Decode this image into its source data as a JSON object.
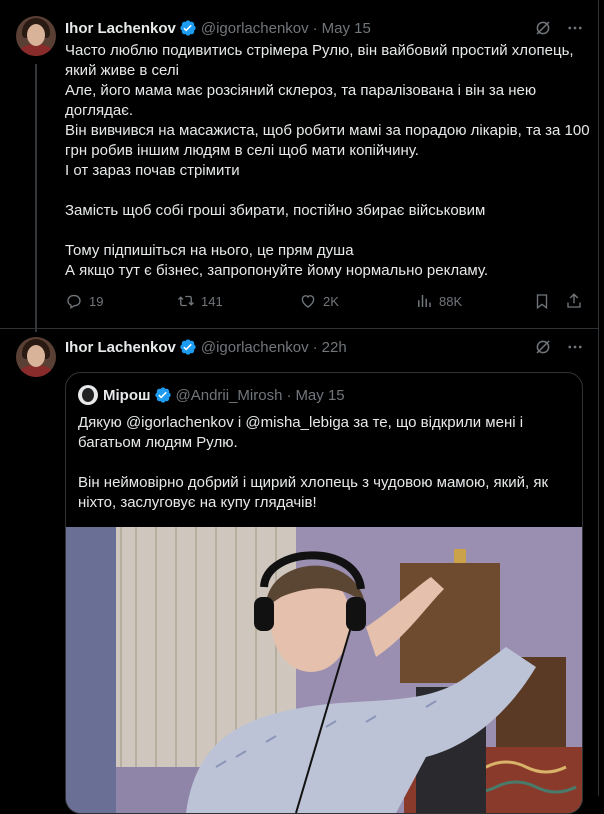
{
  "tweet1": {
    "name": "Ihor Lachenkov",
    "handle": "@igorlachenkov",
    "separator": "·",
    "date": "May 15",
    "lines": [
      "Часто люблю подивитись стрімера Рулю, він вайбовий простий хлопець,",
      "який живе в селі",
      "Але, його мама має розсіяний склероз, та паралізована і він за нею",
      "доглядає.",
      "Він вивчився на масажиста, щоб робити мамі за порадою лікарів, та за 100",
      "грн робив іншим людям в селі щоб мати копійчину.",
      "І от зараз почав стрімити",
      "Замість щоб собі гроші збирати, постійно збирає військовим",
      "Тому підпишіться на нього, це прям душа",
      "А якщо тут є бізнес, запропонуйте йому нормально рекламу."
    ],
    "actions": {
      "replies": "19",
      "reposts": "141",
      "likes": "2K",
      "views": "88K"
    }
  },
  "tweet2": {
    "name": "Ihor Lachenkov",
    "handle": "@igorlachenkov",
    "separator": "·",
    "date": "22h",
    "quote": {
      "name": "Мірош",
      "handle": "@Andrii_Mirosh",
      "separator": "·",
      "date": "May 15",
      "line1_prefix": "Дякую ",
      "mention1": "@igorlachenkov",
      "line1_mid": " і ",
      "mention2": "@misha_lebiga",
      "line1_suffix": " за те, що відкрили мені і",
      "line2": "багатьом людям Рулю.",
      "line3": "Він неймовірно добрий і щирий хлопець з чудовою мамою, який, як",
      "line4": "ніхто, заслуговує на купу глядачів!"
    }
  },
  "colors": {
    "background": "#000000",
    "text": "#e7e9ea",
    "muted": "#71767b",
    "verified": "#1d9bf0",
    "border": "#2f3336"
  },
  "icons": [
    "grok-icon",
    "more-icon",
    "verified-icon",
    "reply-icon",
    "repost-icon",
    "like-icon",
    "views-icon",
    "bookmark-icon",
    "share-icon"
  ]
}
